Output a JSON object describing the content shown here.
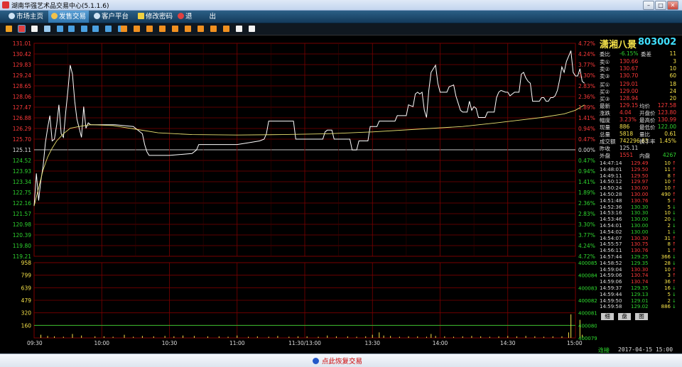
{
  "window": {
    "title": "湖南华强艺术品交易中心(5.1.1.6)"
  },
  "nav": [
    {
      "label": "市场主页",
      "active": false
    },
    {
      "label": "发售交易",
      "active": true
    },
    {
      "label": "客户平台",
      "active": false
    },
    {
      "label": "修改密码",
      "active": false
    },
    {
      "label": "退",
      "active": false
    },
    {
      "label": "出",
      "active": false
    }
  ],
  "toolbar_icons": [
    "bar-chart-icon",
    "line-chart-icon",
    "candle-icon",
    "calculator-icon",
    "grid-icon",
    "table-icon",
    "trade-icon",
    "doc-icon",
    "tool-icon",
    "x-icon",
    "order-1-icon",
    "order-2-icon",
    "order-3-icon",
    "order-4-icon",
    "order-5-icon",
    "order-6-icon",
    "order-7-icon",
    "order-8-icon",
    "order-9-icon",
    "edit-icon",
    "settings-icon"
  ],
  "stock": {
    "name": "潇湘八景",
    "code": "803002"
  },
  "order_book": {
    "ratio": {
      "label": "委比",
      "value": "-6.15%",
      "label2": "委差",
      "value2": "11"
    },
    "asks": [
      {
        "label": "卖③",
        "price": "130.70",
        "vol": "60"
      },
      {
        "label": "卖②",
        "price": "130.67",
        "vol": "10"
      },
      {
        "label": "卖①",
        "price": "130.66",
        "vol": "3"
      }
    ],
    "bids": [
      {
        "label": "买①",
        "price": "129.01",
        "vol": "18"
      },
      {
        "label": "买②",
        "price": "129.00",
        "vol": "24"
      },
      {
        "label": "买③",
        "price": "128.94",
        "vol": "20"
      }
    ]
  },
  "stats": [
    {
      "l1": "最新",
      "v1": "129.15",
      "l2": "均价",
      "v2": "127.58"
    },
    {
      "l1": "涨跌",
      "v1": "4.04",
      "l2": "开盘价",
      "v2": "123.80"
    },
    {
      "l1": "幅度",
      "v1": "3.23%",
      "l2": "最高价",
      "v2": "130.99"
    },
    {
      "l1": "现量",
      "v1": "886",
      "l2": "最低价",
      "v2": "122.00"
    },
    {
      "l1": "总量",
      "v1": "5818",
      "l2": "量比",
      "v2": "0.61"
    },
    {
      "l1": "成交额",
      "v1": "742296.83",
      "l2": "换手率",
      "v2": "1.45%"
    },
    {
      "l1": "昨收",
      "v1": "125.11",
      "l2": "",
      "v2": ""
    },
    {
      "l1": "外盘",
      "v1": "1551",
      "l2": "内盘",
      "v2": "4267"
    }
  ],
  "ticks": [
    {
      "time": "14:47:14",
      "price": "129.49",
      "vol": "10",
      "dir": "up"
    },
    {
      "time": "14:48:01",
      "price": "129.50",
      "vol": "11",
      "dir": "up"
    },
    {
      "time": "14:49:11",
      "price": "129.50",
      "vol": "8",
      "dir": "up"
    },
    {
      "time": "14:50:12",
      "price": "129.97",
      "vol": "10",
      "dir": "up"
    },
    {
      "time": "14:50:24",
      "price": "130.00",
      "vol": "10",
      "dir": "up"
    },
    {
      "time": "14:50:28",
      "price": "130.00",
      "vol": "490",
      "dir": "up"
    },
    {
      "time": "14:51:48",
      "price": "130.76",
      "vol": "5",
      "dir": "up"
    },
    {
      "time": "14:52:36",
      "price": "130.30",
      "vol": "5",
      "dir": "down"
    },
    {
      "time": "14:53:16",
      "price": "130.30",
      "vol": "10",
      "dir": "down"
    },
    {
      "time": "14:53:46",
      "price": "130.00",
      "vol": "20",
      "dir": "down"
    },
    {
      "time": "14:54:01",
      "price": "130.00",
      "vol": "2",
      "dir": "down"
    },
    {
      "time": "14:54:02",
      "price": "130.00",
      "vol": "1",
      "dir": "down"
    },
    {
      "time": "14:54:07",
      "price": "130.30",
      "vol": "31",
      "dir": "up"
    },
    {
      "time": "14:55:57",
      "price": "130.75",
      "vol": "8",
      "dir": "up"
    },
    {
      "time": "14:56:11",
      "price": "130.76",
      "vol": "1",
      "dir": "up"
    },
    {
      "time": "14:57:44",
      "price": "129.25",
      "vol": "366",
      "dir": "down"
    },
    {
      "time": "14:58:52",
      "price": "129.35",
      "vol": "28",
      "dir": "down"
    },
    {
      "time": "14:59:04",
      "price": "130.30",
      "vol": "10",
      "dir": "up"
    },
    {
      "time": "14:59:06",
      "price": "130.74",
      "vol": "3",
      "dir": "up"
    },
    {
      "time": "14:59:06",
      "price": "130.74",
      "vol": "36",
      "dir": "up"
    },
    {
      "time": "14:59:37",
      "price": "129.35",
      "vol": "16",
      "dir": "down"
    },
    {
      "time": "14:59:44",
      "price": "129.13",
      "vol": "5",
      "dir": "down"
    },
    {
      "time": "14:59:50",
      "price": "129.01",
      "vol": "2",
      "dir": "down"
    },
    {
      "time": "14:59:58",
      "price": "129.02",
      "vol": "886",
      "dir": "down"
    }
  ],
  "tabs": [
    "细",
    "盘",
    "图"
  ],
  "status": {
    "conn": "连接",
    "datetime": "2017-04-15 15:00"
  },
  "footer": {
    "resume": "点此恢复交易"
  },
  "colors": {
    "up": "#ff3a3a",
    "down": "#2fd52f",
    "grid": "#7a0000",
    "price_line": "#ffffff",
    "avg_line": "#e8e070"
  },
  "chart_data": {
    "type": "line",
    "title": "",
    "prev_close": 125.11,
    "price_ticks": [
      "131.01",
      "130.42",
      "129.83",
      "129.24",
      "128.65",
      "128.06",
      "127.47",
      "126.88",
      "126.29",
      "125.70",
      "125.11",
      "124.52",
      "123.93",
      "123.34",
      "122.75",
      "122.16",
      "121.57",
      "120.98",
      "120.39",
      "119.80",
      "119.21"
    ],
    "pct_ticks": [
      "4.72%",
      "4.24%",
      "3.77%",
      "3.30%",
      "2.83%",
      "2.36%",
      "1.89%",
      "1.41%",
      "0.94%",
      "0.47%",
      "0.00%",
      "0.47%",
      "0.94%",
      "1.41%",
      "1.89%",
      "2.36%",
      "2.83%",
      "3.30%",
      "3.77%",
      "4.24%",
      "4.72%"
    ],
    "ylim": [
      119.21,
      131.01
    ],
    "time_labels": [
      "09:30",
      "10:00",
      "10:30",
      "11:00",
      "11:30/13:00",
      "13:30",
      "14:00",
      "14:30",
      "15:00"
    ],
    "x_range": [
      0,
      240
    ],
    "series": [
      {
        "name": "",
        "color": "#ffffff",
        "points": [
          [
            0,
            122.0
          ],
          [
            1,
            123.8
          ],
          [
            2,
            122.3
          ],
          [
            3,
            123.4
          ],
          [
            4,
            124.2
          ],
          [
            5,
            125.5
          ],
          [
            6,
            126.3
          ],
          [
            7,
            127.0
          ],
          [
            8,
            125.6
          ],
          [
            9,
            125.7
          ],
          [
            10,
            126.5
          ],
          [
            11,
            127.6
          ],
          [
            12,
            126.0
          ],
          [
            13,
            125.8
          ],
          [
            14,
            127.2
          ],
          [
            15,
            128.4
          ],
          [
            16,
            129.8
          ],
          [
            17,
            129.3
          ],
          [
            18,
            127.8
          ],
          [
            19,
            126.8
          ],
          [
            20,
            126.3
          ],
          [
            21,
            125.8
          ],
          [
            22,
            127.5
          ],
          [
            23,
            126.3
          ],
          [
            24,
            126.6
          ],
          [
            25,
            126.5
          ],
          [
            36,
            126.5
          ],
          [
            44,
            126.4
          ],
          [
            48,
            126.0
          ],
          [
            49,
            125.4
          ],
          [
            50,
            125.0
          ],
          [
            51,
            124.8
          ],
          [
            60,
            124.8
          ],
          [
            70,
            124.9
          ],
          [
            72,
            125.1
          ],
          [
            73,
            125.4
          ],
          [
            80,
            125.4
          ],
          [
            90,
            125.4
          ],
          [
            95,
            125.5
          ],
          [
            100,
            125.6
          ],
          [
            102,
            125.7
          ],
          [
            103,
            126.0
          ],
          [
            104,
            126.7
          ],
          [
            115,
            126.7
          ],
          [
            116,
            125.7
          ],
          [
            128,
            125.7
          ],
          [
            129,
            126.1
          ],
          [
            130,
            126.2
          ],
          [
            132,
            126.2
          ],
          [
            133,
            125.7
          ],
          [
            140,
            125.7
          ],
          [
            141,
            125.1
          ],
          [
            143,
            125.1
          ],
          [
            144,
            125.6
          ],
          [
            148,
            125.6
          ],
          [
            149,
            126.4
          ],
          [
            152,
            126.4
          ],
          [
            153,
            126.7
          ],
          [
            160,
            126.7
          ],
          [
            161,
            127.0
          ],
          [
            165,
            127.0
          ],
          [
            166,
            127.6
          ],
          [
            168,
            127.5
          ],
          [
            169,
            128.2
          ],
          [
            170,
            128.3
          ],
          [
            171,
            128.2
          ],
          [
            172,
            128.3
          ],
          [
            173,
            127.3
          ],
          [
            174,
            126.9
          ],
          [
            175,
            128.4
          ],
          [
            176,
            129.4
          ],
          [
            178,
            129.8
          ],
          [
            179,
            128.8
          ],
          [
            180,
            128.3
          ],
          [
            183,
            128.3
          ],
          [
            184,
            128.6
          ],
          [
            186,
            128.7
          ],
          [
            187,
            128.1
          ],
          [
            188,
            127.7
          ],
          [
            189,
            127.3
          ],
          [
            190,
            127.2
          ],
          [
            192,
            127.2
          ],
          [
            193,
            127.8
          ],
          [
            194,
            127.3
          ],
          [
            195,
            127.5
          ],
          [
            196,
            127.4
          ],
          [
            197,
            126.9
          ],
          [
            200,
            126.9
          ],
          [
            201,
            127.2
          ],
          [
            204,
            127.2
          ],
          [
            205,
            128.0
          ],
          [
            206,
            128.3
          ],
          [
            207,
            128.4
          ],
          [
            209,
            128.3
          ],
          [
            210,
            128.3
          ],
          [
            211,
            128.1
          ],
          [
            212,
            128.2
          ],
          [
            213,
            128.3
          ],
          [
            215,
            128.3
          ],
          [
            216,
            129.3
          ],
          [
            217,
            129.4
          ],
          [
            218,
            129.1
          ],
          [
            219,
            128.9
          ],
          [
            220,
            128.8
          ],
          [
            221,
            127.8
          ],
          [
            222,
            127.8
          ],
          [
            224,
            127.8
          ],
          [
            225,
            128.0
          ],
          [
            226,
            128.0
          ],
          [
            227,
            127.8
          ],
          [
            228,
            127.8
          ],
          [
            229,
            128.0
          ],
          [
            230,
            128.0
          ],
          [
            231,
            128.1
          ],
          [
            232,
            128.4
          ],
          [
            233,
            129.0
          ],
          [
            234,
            129.7
          ],
          [
            235,
            129.4
          ],
          [
            236,
            130.0
          ],
          [
            237,
            130.3
          ],
          [
            238,
            130.6
          ],
          [
            239,
            129.4
          ],
          [
            240,
            129.2
          ],
          [
            241,
            129.2
          ],
          [
            242,
            129.6
          ],
          [
            243,
            128.9
          ],
          [
            244,
            128.8
          ]
        ]
      },
      {
        "name": "",
        "color": "#e8e070",
        "points": [
          [
            0,
            122.0
          ],
          [
            2,
            123.0
          ],
          [
            4,
            124.0
          ],
          [
            6,
            124.7
          ],
          [
            8,
            125.2
          ],
          [
            10,
            125.6
          ],
          [
            13,
            126.0
          ],
          [
            16,
            126.3
          ],
          [
            20,
            126.4
          ],
          [
            25,
            126.5
          ],
          [
            35,
            126.45
          ],
          [
            45,
            126.25
          ],
          [
            55,
            126.05
          ],
          [
            70,
            125.95
          ],
          [
            90,
            125.93
          ],
          [
            110,
            125.95
          ],
          [
            130,
            126.0
          ],
          [
            150,
            126.1
          ],
          [
            170,
            126.25
          ],
          [
            190,
            126.4
          ],
          [
            205,
            126.6
          ],
          [
            215,
            126.75
          ],
          [
            225,
            126.9
          ],
          [
            235,
            127.1
          ],
          [
            240,
            127.3
          ],
          [
            244,
            127.6
          ]
        ]
      }
    ],
    "volume": {
      "left_ticks": [
        "958",
        "799",
        "639",
        "479",
        "320",
        "160"
      ],
      "right_ticks": [
        "400085",
        "400084",
        "400083",
        "400082",
        "400081",
        "400080",
        "400079"
      ],
      "ylim": [
        0,
        958
      ],
      "bars": [
        [
          3,
          40
        ],
        [
          6,
          25
        ],
        [
          9,
          20
        ],
        [
          13,
          15
        ],
        [
          17,
          50
        ],
        [
          21,
          30
        ],
        [
          27,
          20
        ],
        [
          31,
          20
        ],
        [
          35,
          15
        ],
        [
          40,
          40
        ],
        [
          44,
          15
        ],
        [
          48,
          25
        ],
        [
          53,
          20
        ],
        [
          58,
          25
        ],
        [
          62,
          20
        ],
        [
          66,
          30
        ],
        [
          71,
          25
        ],
        [
          77,
          20
        ],
        [
          82,
          20
        ],
        [
          86,
          15
        ],
        [
          90,
          30
        ],
        [
          95,
          15
        ],
        [
          99,
          20
        ],
        [
          104,
          15
        ],
        [
          108,
          25
        ],
        [
          113,
          15
        ],
        [
          117,
          20
        ],
        [
          121,
          20
        ],
        [
          126,
          15
        ],
        [
          130,
          30
        ],
        [
          134,
          20
        ],
        [
          139,
          20
        ],
        [
          143,
          15
        ],
        [
          147,
          20
        ],
        [
          150,
          40
        ],
        [
          153,
          70
        ],
        [
          155,
          30
        ],
        [
          158,
          25
        ],
        [
          162,
          15
        ],
        [
          166,
          20
        ],
        [
          170,
          20
        ],
        [
          174,
          15
        ],
        [
          176,
          50
        ],
        [
          178,
          25
        ],
        [
          182,
          20
        ],
        [
          186,
          15
        ],
        [
          190,
          20
        ],
        [
          194,
          25
        ],
        [
          198,
          20
        ],
        [
          202,
          15
        ],
        [
          206,
          20
        ],
        [
          210,
          25
        ],
        [
          214,
          20
        ],
        [
          218,
          25
        ],
        [
          222,
          20
        ],
        [
          226,
          15
        ],
        [
          230,
          20
        ],
        [
          234,
          20
        ],
        [
          237,
          70
        ],
        [
          238,
          300
        ],
        [
          242,
          230
        ],
        [
          243,
          40
        ]
      ]
    }
  }
}
